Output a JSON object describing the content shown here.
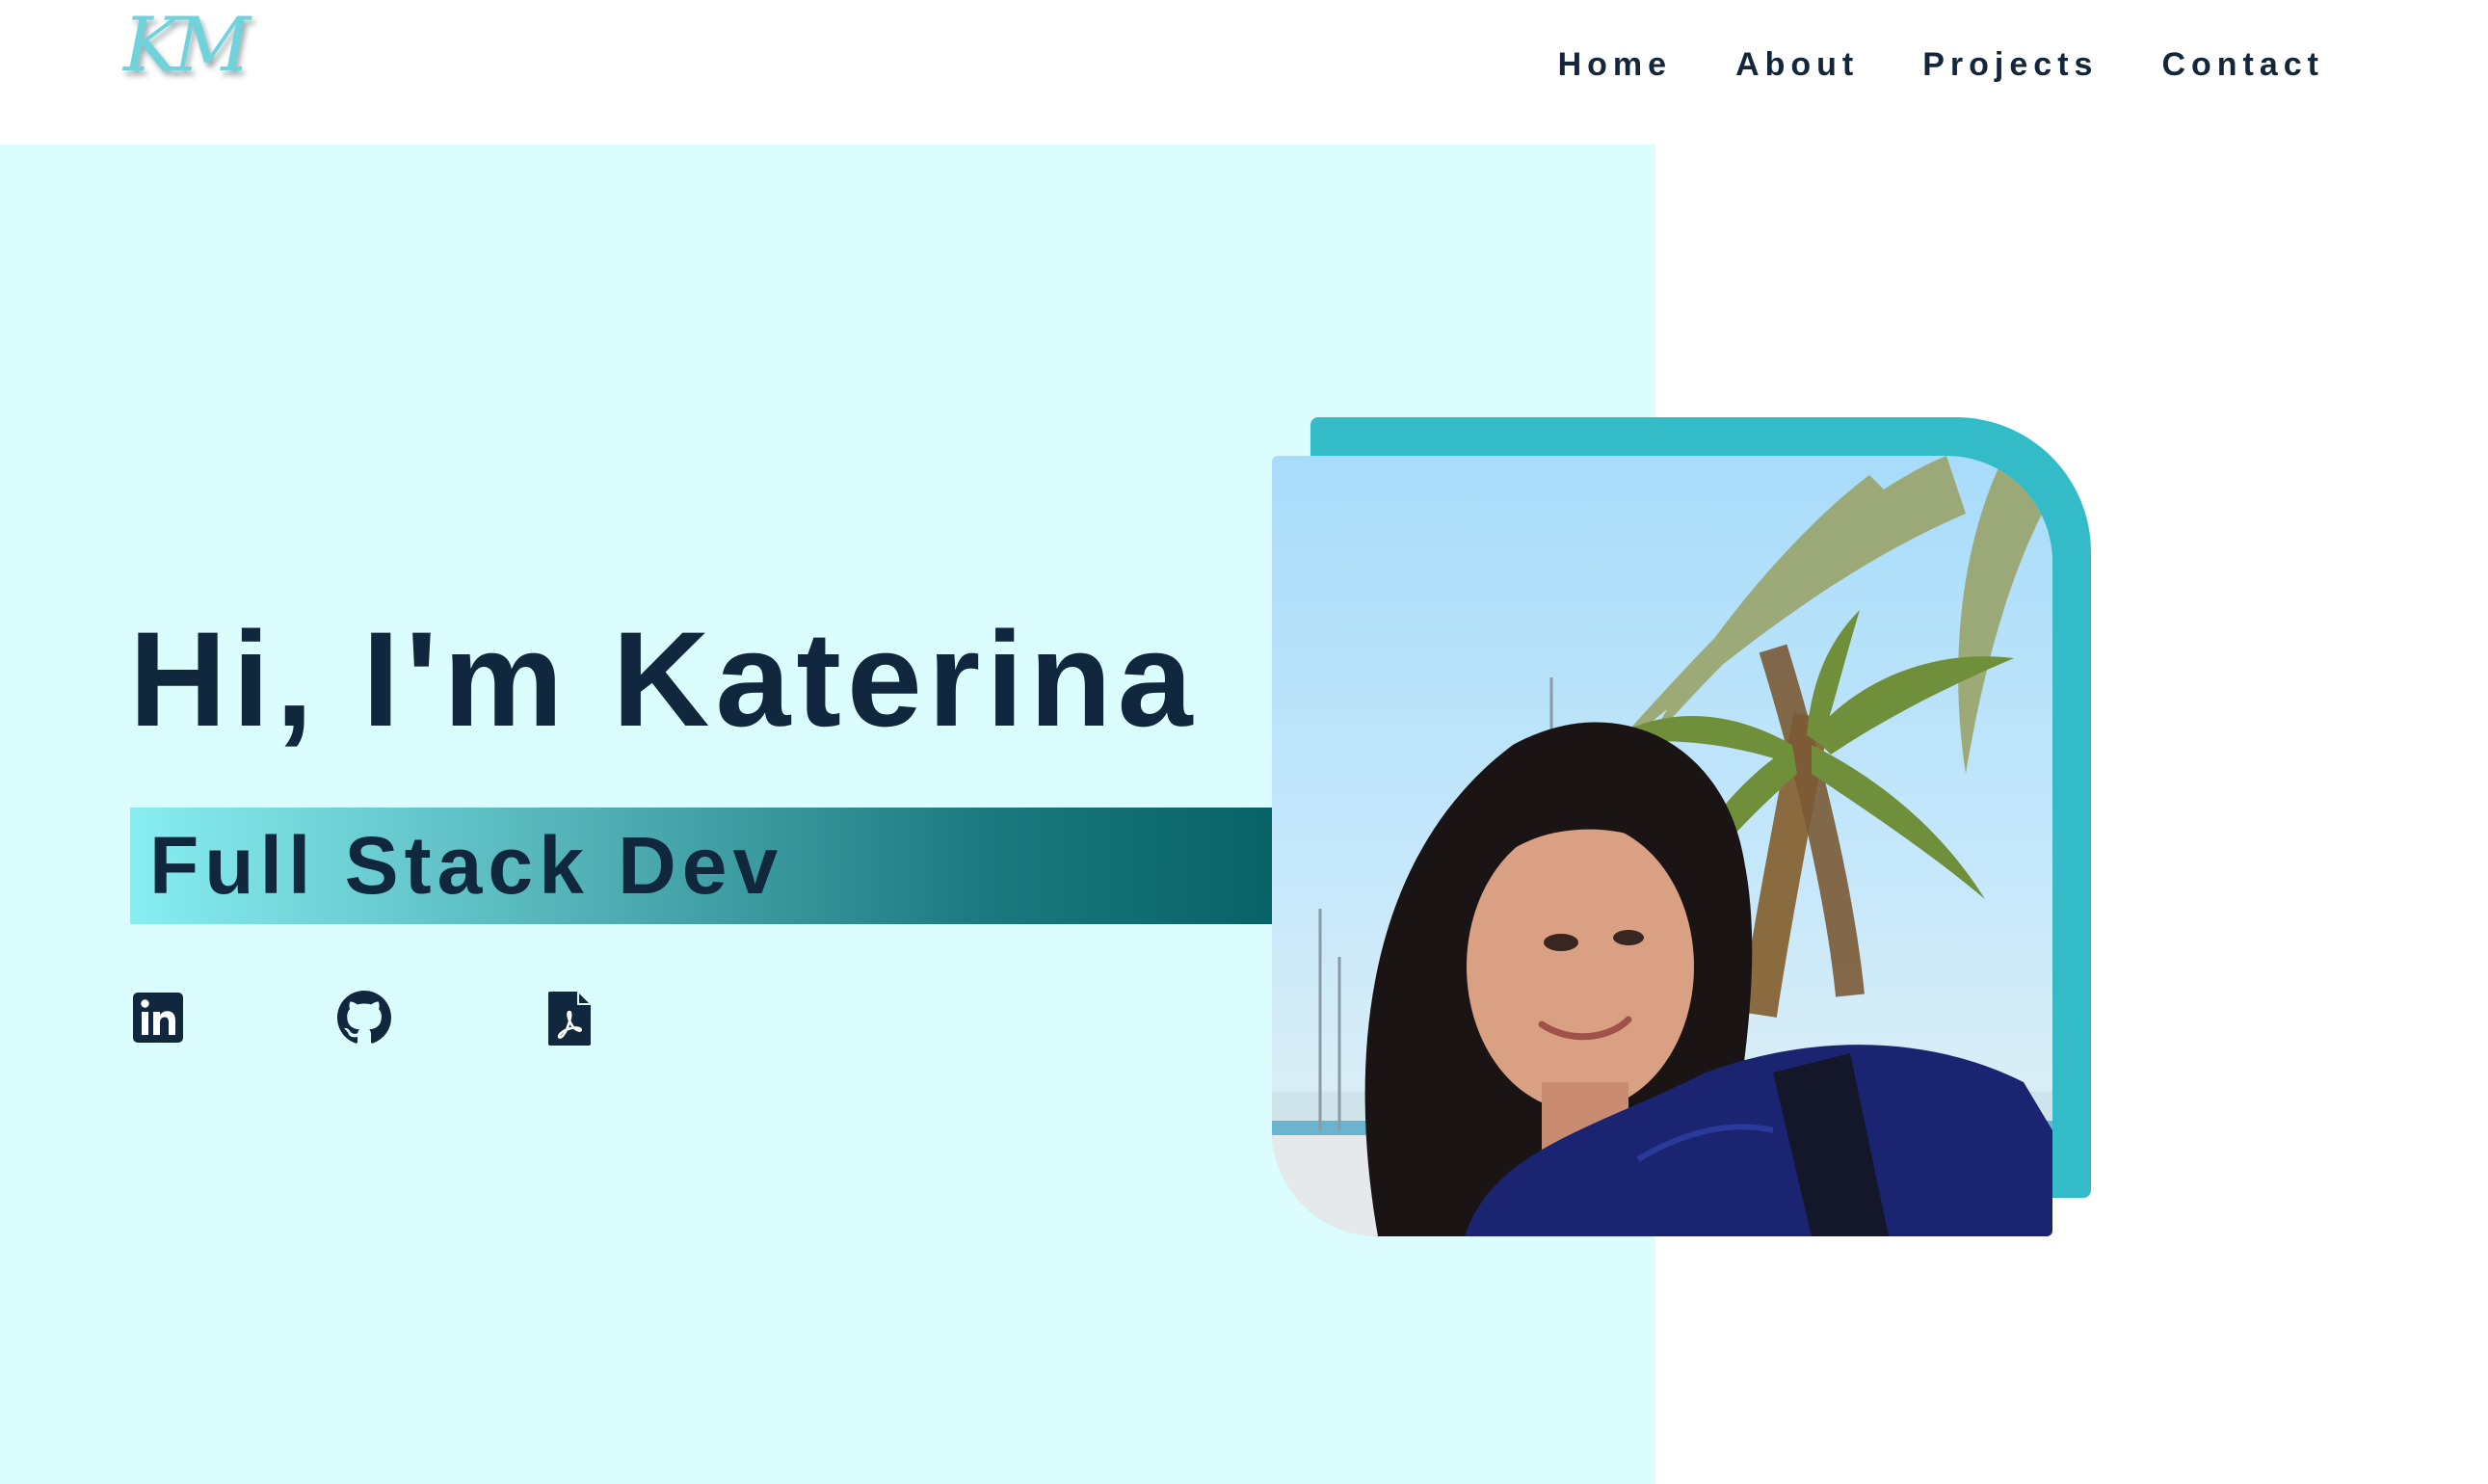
{
  "header": {
    "logo_text": "KM",
    "nav": [
      {
        "label": "Home"
      },
      {
        "label": "About"
      },
      {
        "label": "Projects"
      },
      {
        "label": "Contact"
      }
    ]
  },
  "hero": {
    "greeting": "Hi, I'm Katerina",
    "role": "Full Stack Dev",
    "social_icons": [
      "linkedin-icon",
      "github-icon",
      "pdf-resume-icon"
    ],
    "photo_description_icon": "profile-photo"
  },
  "colors": {
    "text_dark": "#10273d",
    "panel_bg": "#dcfdfd",
    "accent": "#33bcc7",
    "gradient_start": "#88eef1",
    "gradient_end": "#076266",
    "logo": "#6fd3dd"
  }
}
